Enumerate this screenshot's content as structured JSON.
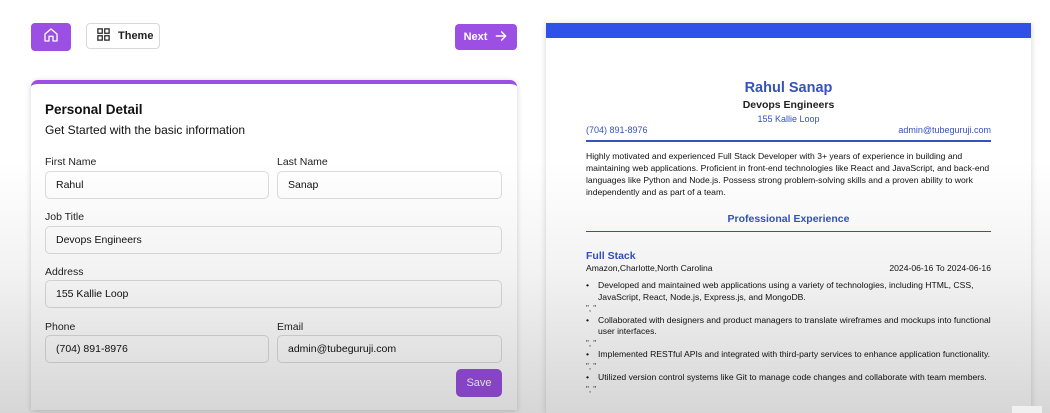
{
  "toolbar": {
    "home_icon": "home-icon",
    "theme_label": "Theme",
    "theme_icon": "grid-icon",
    "next_label": "Next",
    "next_icon": "arrow-right-icon"
  },
  "form": {
    "title": "Personal Detail",
    "subtitle": "Get Started with the basic information",
    "first_name_label": "First Name",
    "first_name_value": "Rahul",
    "last_name_label": "Last Name",
    "last_name_value": "Sanap",
    "job_title_label": "Job Title",
    "job_title_value": "Devops Engineers",
    "address_label": "Address",
    "address_value": "155 Kallie Loop",
    "phone_label": "Phone",
    "phone_value": "(704) 891-8976",
    "email_label": "Email",
    "email_value": "admin@tubeguruji.com",
    "save_label": "Save"
  },
  "resume": {
    "name": "Rahul Sanap",
    "job_title": "Devops Engineers",
    "address": "155 Kallie Loop",
    "phone": "(704) 891-8976",
    "email": "admin@tubeguruji.com",
    "summary": "Highly motivated and experienced Full Stack Developer with 3+ years of experience in building and maintaining web applications. Proficient in front-end technologies like React and JavaScript, and back-end languages like Python and Node.js. Possess strong problem-solving skills and a proven ability to work independently and as part of a team.",
    "section_title": "Professional Experience",
    "experience": {
      "title": "Full Stack",
      "company": "Amazon,Charlotte,North Carolina",
      "dates": "2024-06-16 To 2024-06-16",
      "bullets": [
        "Developed and maintained web applications using a variety of technologies, including HTML, CSS, JavaScript, React, Node.js, Express.js, and MongoDB.",
        "Collaborated with designers and product managers to translate wireframes and mockups into functional user interfaces.",
        "Implemented RESTful APIs and integrated with third-party services to enhance application functionality.",
        "Utilized version control systems like Git to manage code changes and collaborate with team members."
      ],
      "separator": "\", \"",
      "bullet_marker": "•"
    }
  },
  "colors": {
    "accent_purple": "#9b4fe3",
    "resume_blue": "#2f51e8",
    "resume_text_blue": "#3452c0"
  }
}
